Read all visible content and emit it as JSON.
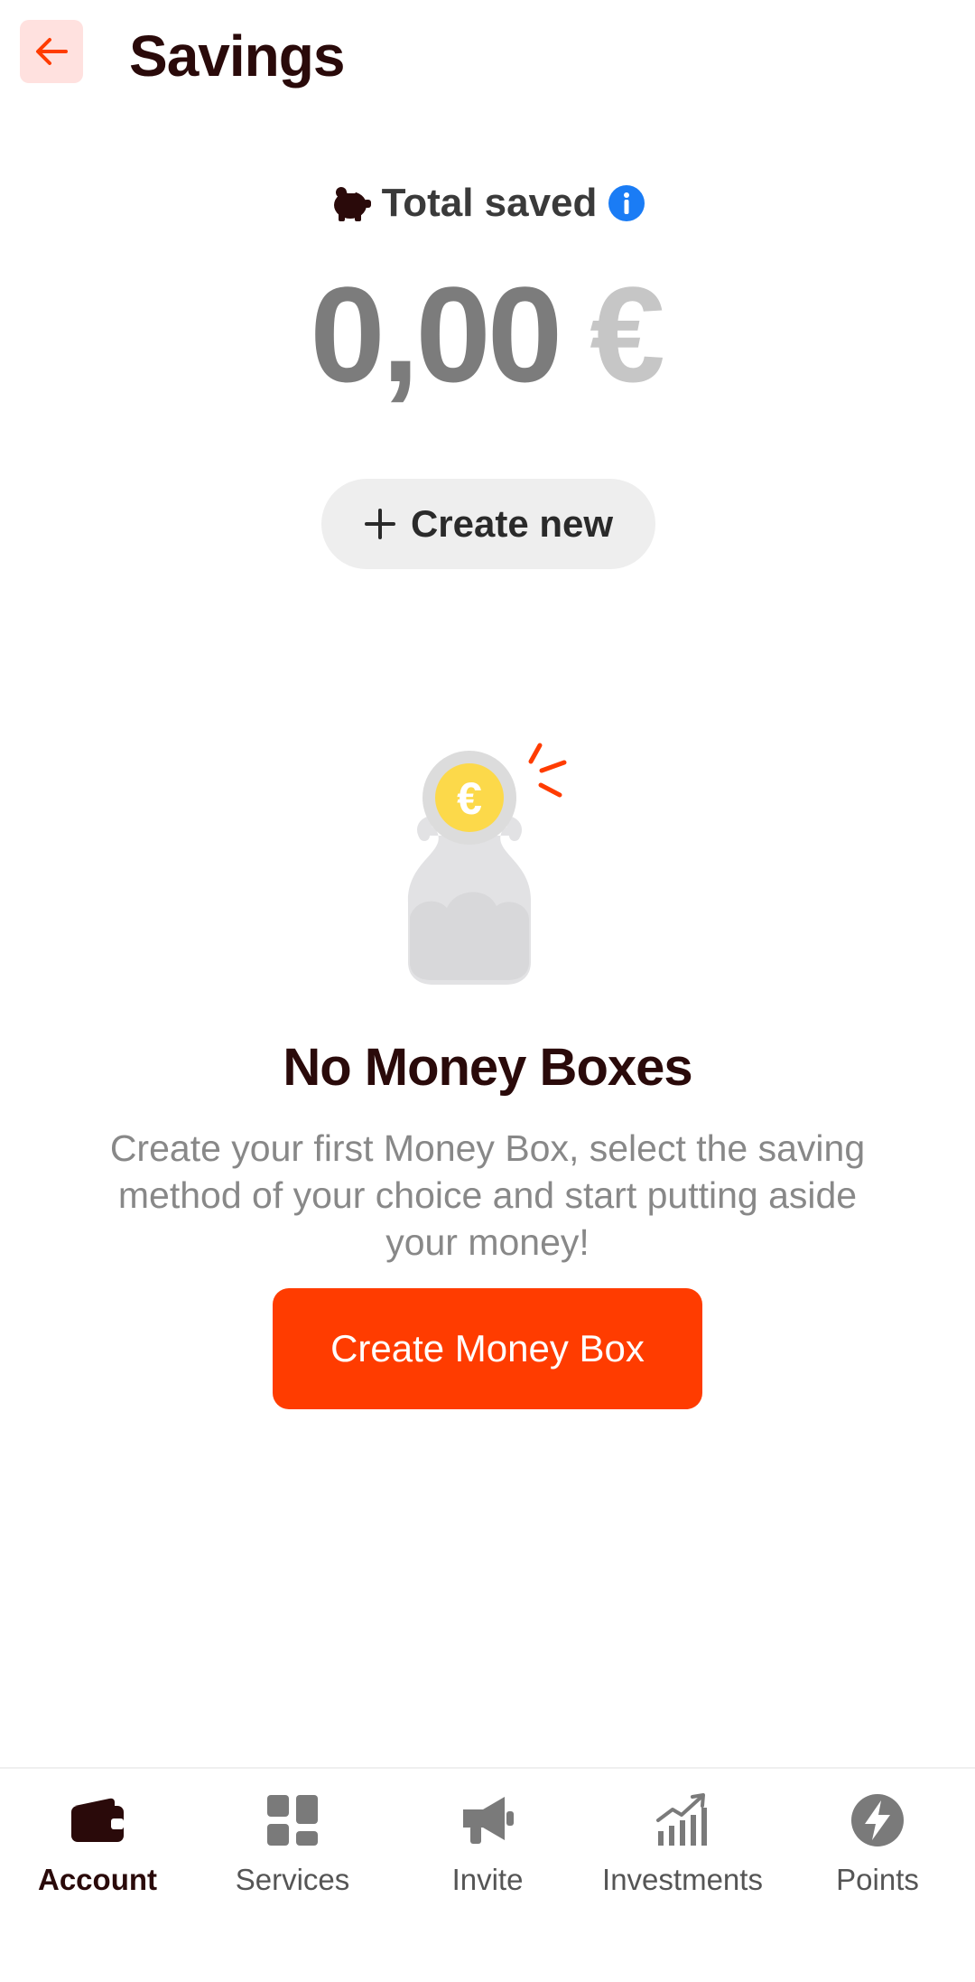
{
  "header": {
    "title": "Savings",
    "back_icon": "arrow-left-icon"
  },
  "summary": {
    "total_label": "Total saved",
    "amount": "0,00",
    "currency": "€",
    "piggy_icon": "piggy-bank-icon",
    "info_icon": "info-icon"
  },
  "actions": {
    "create_new_label": "Create new"
  },
  "empty_state": {
    "title": "No Money Boxes",
    "description": "Create your first Money Box, select the saving method of your choice and start putting aside your money!",
    "button_label": "Create Money Box",
    "coin_symbol": "€"
  },
  "nav": {
    "items": [
      {
        "label": "Account",
        "icon": "wallet-icon",
        "active": true
      },
      {
        "label": "Services",
        "icon": "grid-icon",
        "active": false
      },
      {
        "label": "Invite",
        "icon": "megaphone-icon",
        "active": false
      },
      {
        "label": "Investments",
        "icon": "chart-icon",
        "active": false
      },
      {
        "label": "Points",
        "icon": "lightning-icon",
        "active": false
      }
    ]
  },
  "colors": {
    "accent": "#ff3c00",
    "back_bg": "#ffe1df",
    "title": "#2a0a0a",
    "info": "#1a7cf5",
    "coin": "#fcd94a"
  }
}
